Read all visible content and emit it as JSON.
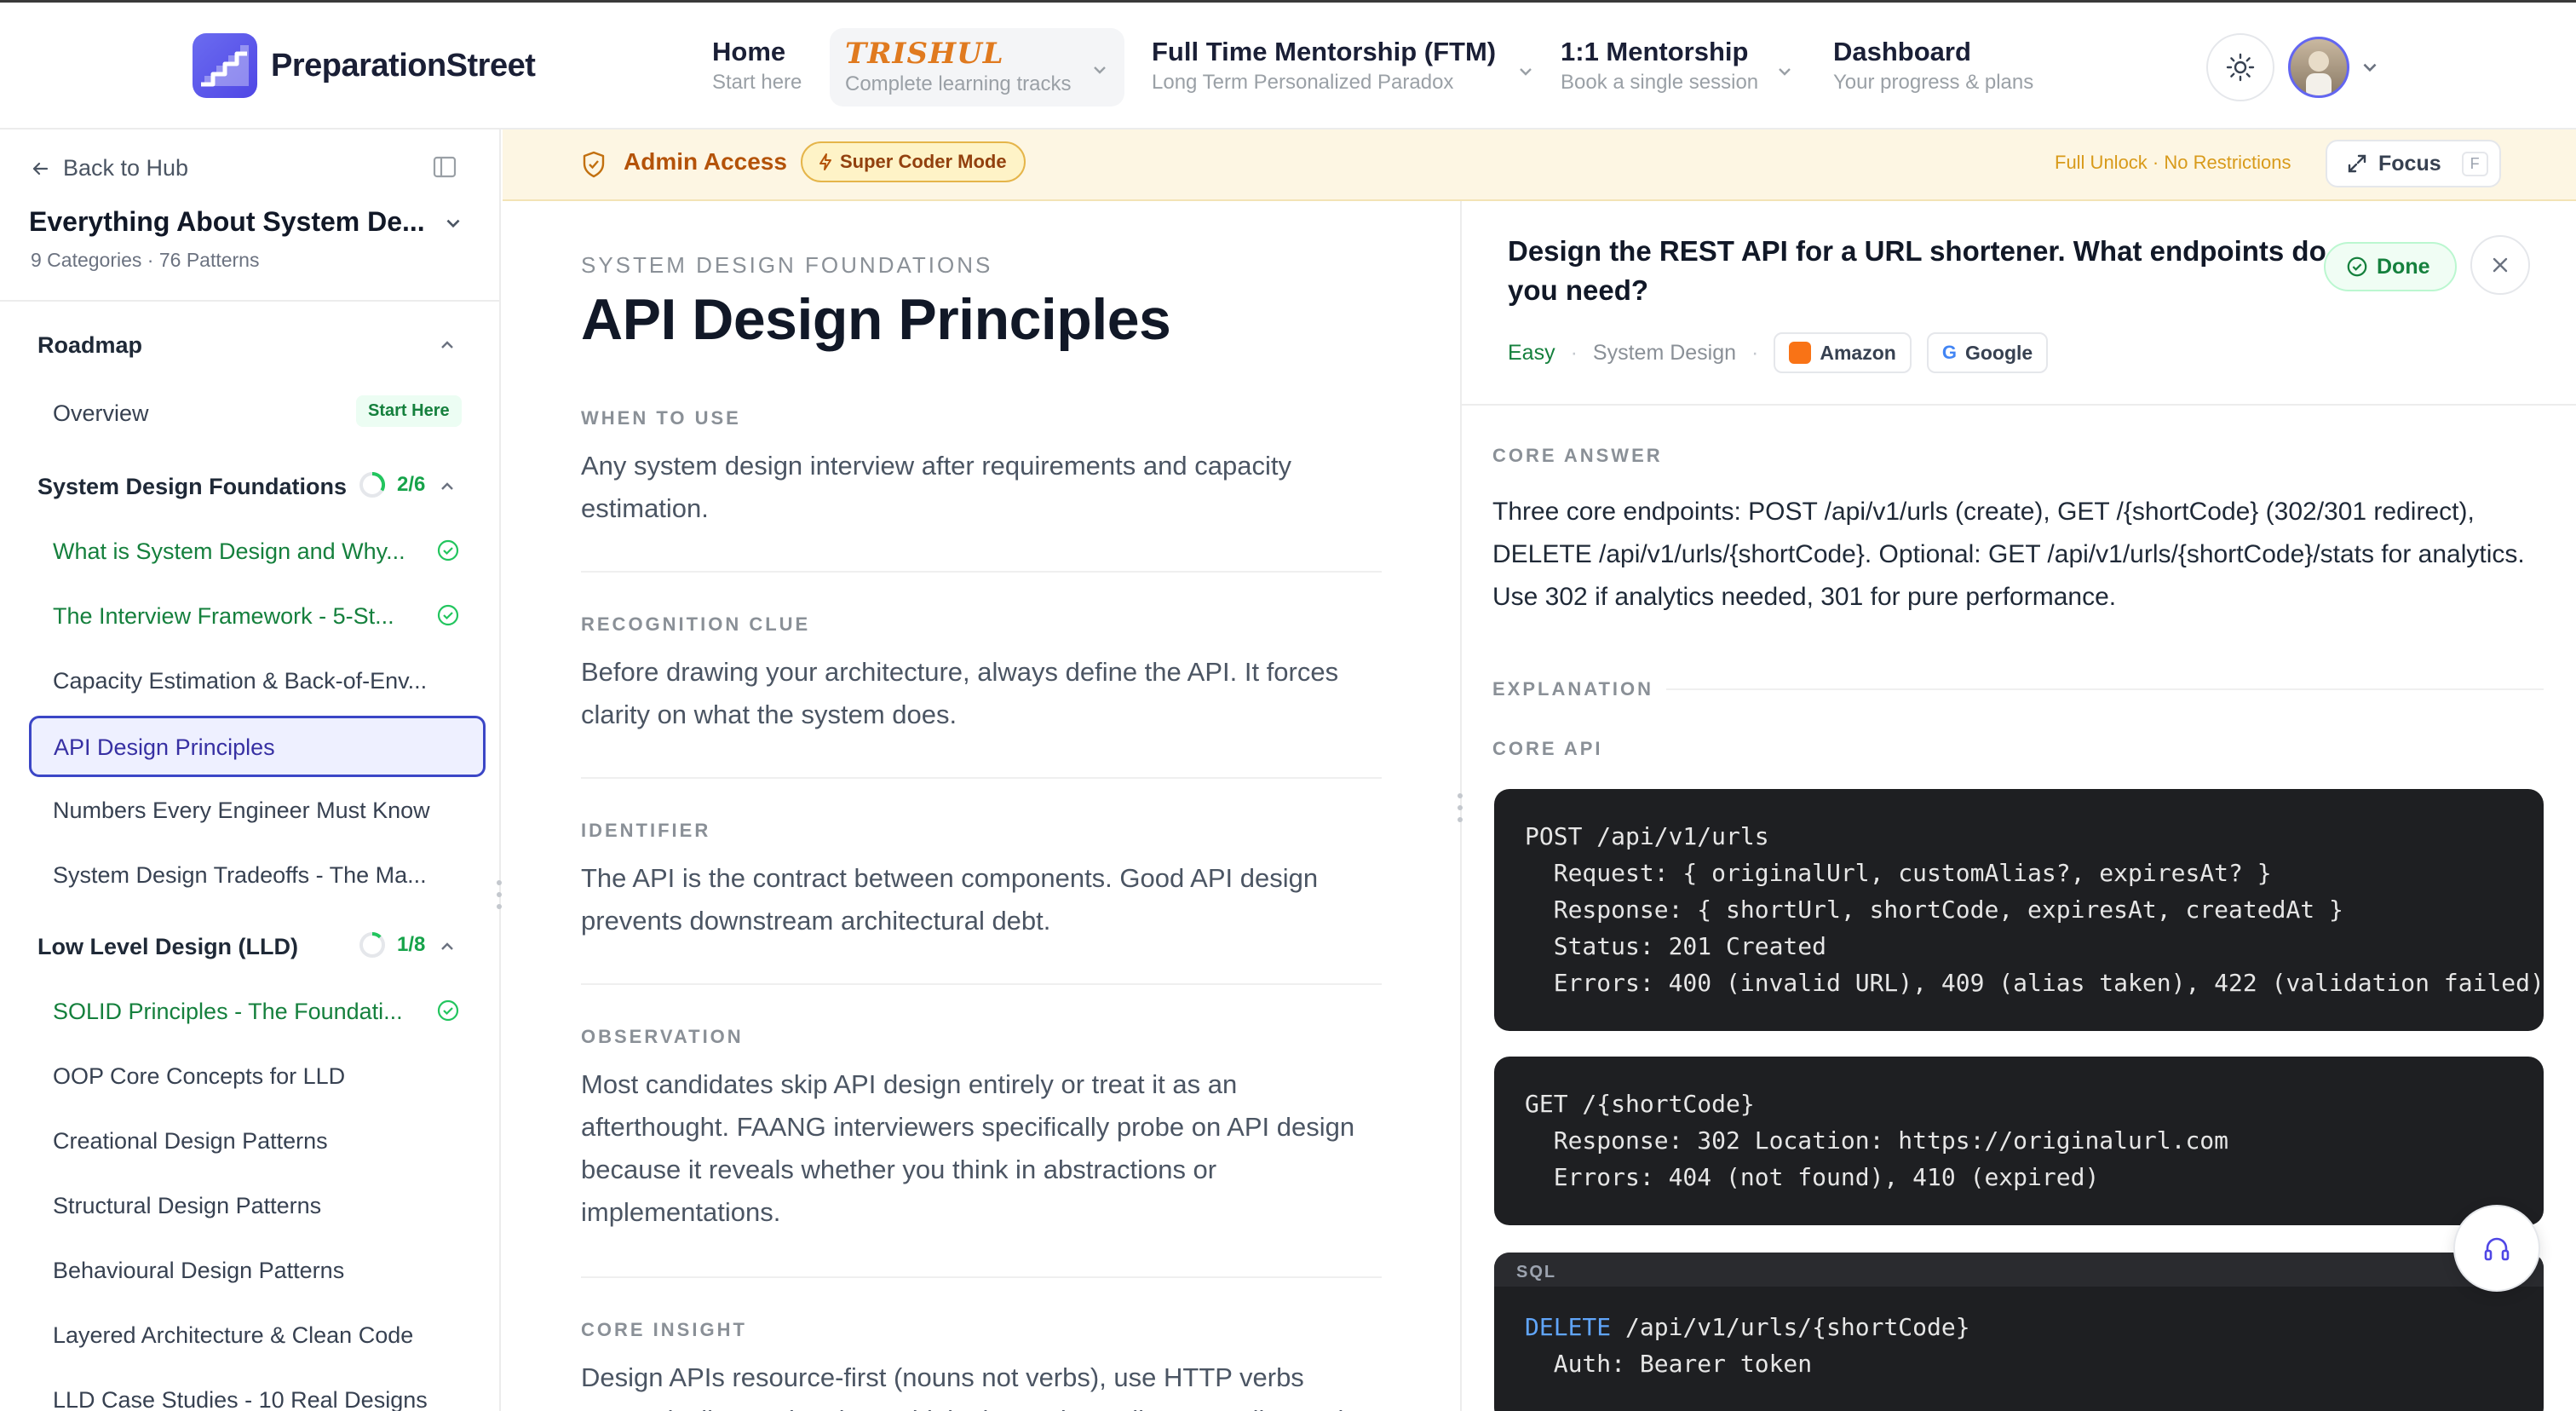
{
  "brand": {
    "name_a": "Preparation",
    "name_b": "Street"
  },
  "nav": [
    {
      "title": "Home",
      "sub": "Start here"
    },
    {
      "title": "TRISHUL",
      "sub": "Complete learning tracks"
    },
    {
      "title": "Full Time Mentorship (FTM)",
      "sub": "Long Term Personalized Paradox"
    },
    {
      "title": "1:1 Mentorship",
      "sub": "Book a single session"
    },
    {
      "title": "Dashboard",
      "sub": "Your progress & plans"
    }
  ],
  "sidebar": {
    "back": "Back to Hub",
    "course_title": "Everything About System De...",
    "course_sub": "9 Categories · 76 Patterns",
    "roadmap": "Roadmap",
    "overview": "Overview",
    "start_here": "Start Here",
    "section1": {
      "title": "System Design Foundations",
      "progress": "2/6"
    },
    "items1": [
      "What is System Design and Why...",
      "The Interview Framework - 5-St...",
      "Capacity Estimation & Back-of-Env...",
      "API Design Principles",
      "Numbers Every Engineer Must Know",
      "System Design Tradeoffs - The Ma..."
    ],
    "section2": {
      "title": "Low Level Design (LLD)",
      "progress": "1/8"
    },
    "items2": [
      "SOLID Principles - The Foundati...",
      "OOP Core Concepts for LLD",
      "Creational Design Patterns",
      "Structural Design Patterns",
      "Behavioural Design Patterns",
      "Layered Architecture & Clean Code",
      "LLD Case Studies - 10 Real Designs"
    ]
  },
  "banner": {
    "admin": "Admin Access",
    "mode": "Super Coder Mode",
    "unlock": "Full Unlock · No Restrictions",
    "focus": "Focus",
    "focus_key": "F"
  },
  "article": {
    "kicker": "SYSTEM DESIGN FOUNDATIONS",
    "title": "API Design Principles",
    "blocks": [
      {
        "label": "WHEN TO USE",
        "text": "Any system design interview after requirements and capacity estimation."
      },
      {
        "label": "RECOGNITION CLUE",
        "text": "Before drawing your architecture, always define the API. It forces clarity on what the system does."
      },
      {
        "label": "IDENTIFIER",
        "text": "The API is the contract between components. Good API design prevents downstream architectural debt."
      },
      {
        "label": "OBSERVATION",
        "text": "Most candidates skip API design entirely or treat it as an afterthought. FAANG interviewers specifically probe on API design because it reveals whether you think in abstractions or implementations."
      },
      {
        "label": "CORE INSIGHT",
        "text": "Design APIs resource-first (nouns not verbs), use HTTP verbs semantically, version them, think about what callers actually need."
      }
    ]
  },
  "question": {
    "title": "Design the REST API for a URL shortener. What endpoints do you need?",
    "done": "Done",
    "difficulty": "Easy",
    "category": "System Design",
    "companies": [
      "Amazon",
      "Google"
    ],
    "core_answer_label": "CORE ANSWER",
    "core_answer": "Three core endpoints: POST /api/v1/urls (create), GET /{shortCode} (302/301 redirect), DELETE /api/v1/urls/{shortCode}. Optional: GET /api/v1/urls/{shortCode}/stats for analytics. Use 302 if analytics needed, 301 for pure performance.",
    "explanation_label": "EXPLANATION",
    "core_api_label": "CORE API",
    "code1": "POST /api/v1/urls\n  Request: { originalUrl, customAlias?, expiresAt? }\n  Response: { shortUrl, shortCode, expiresAt, createdAt }\n  Status: 201 Created\n  Errors: 400 (invalid URL), 409 (alias taken), 422 (validation failed)",
    "code2": "GET /{shortCode}\n  Response: 302 Location: https://originalurl.com\n  Errors: 404 (not found), 410 (expired)",
    "code3_lang": "SQL",
    "code3_kw": "DELETE",
    "code3_rest": " /api/v1/urls/{shortCode}\n  Auth: Bearer token"
  }
}
